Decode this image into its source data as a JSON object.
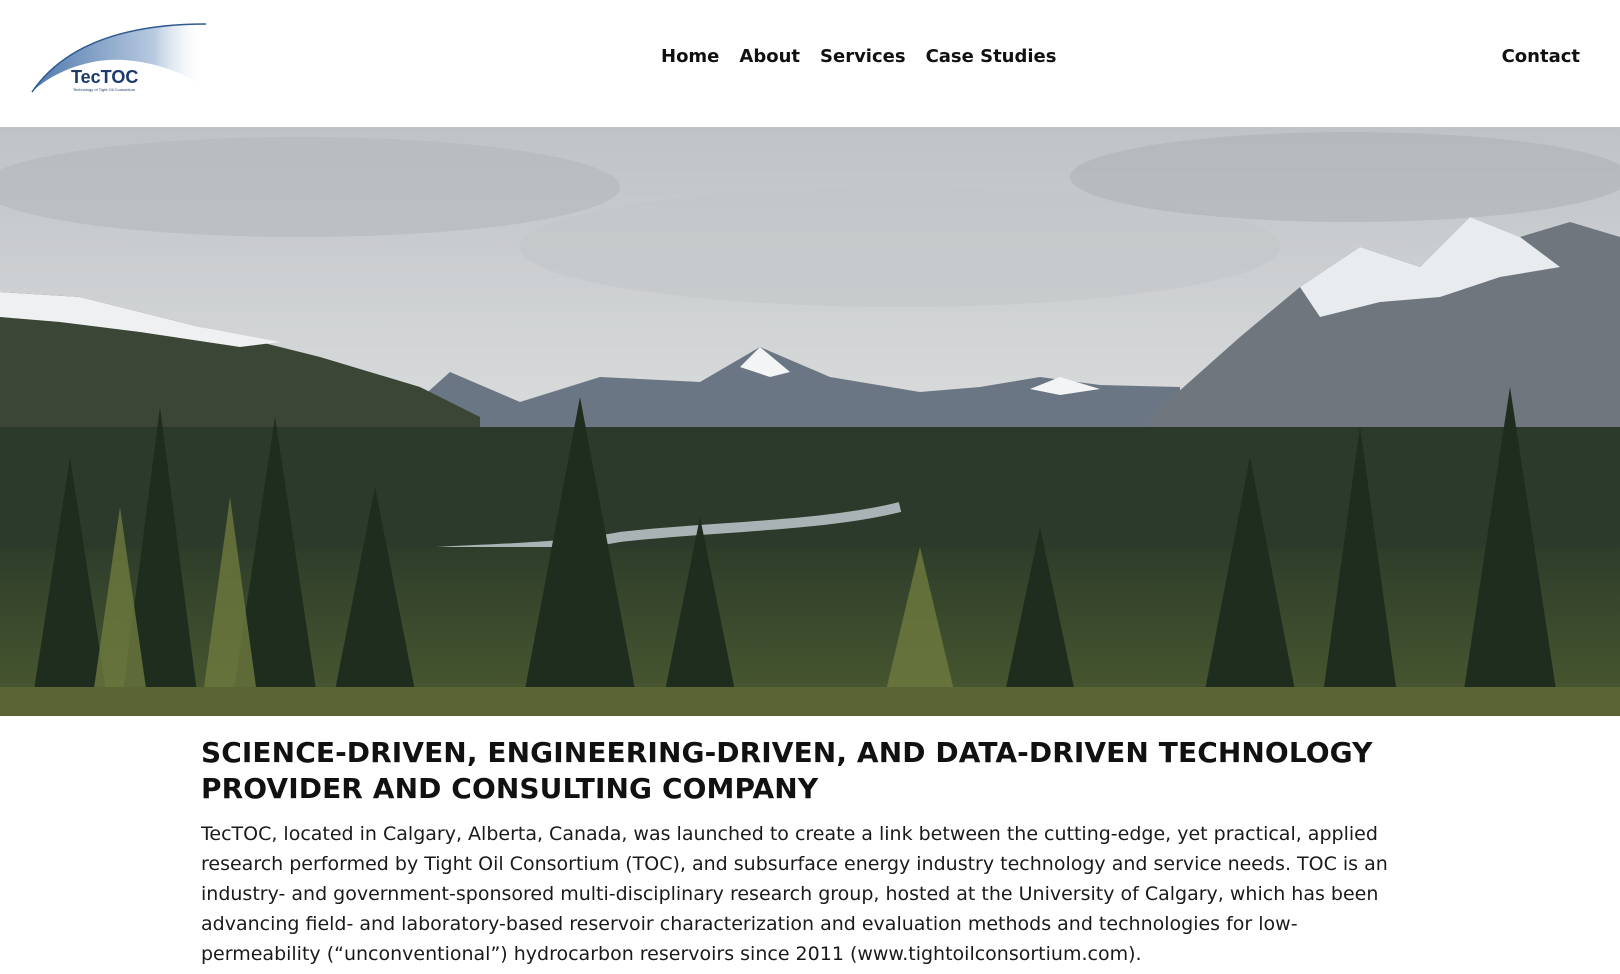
{
  "brand": {
    "logo_text": "TecTOC",
    "logo_tagline": "Technology of Tight Oil Consortium"
  },
  "nav": {
    "items": [
      "Home",
      "About",
      "Services",
      "Case Studies"
    ],
    "contact": "Contact"
  },
  "hero": {
    "image": "mountain-valley-forest-landscape"
  },
  "main": {
    "headline": "SCIENCE-DRIVEN, ENGINEERING-DRIVEN, AND DATA-DRIVEN TECHNOLOGY PROVIDER AND CONSULTING COMPANY",
    "paragraph": "TecTOC, located in Calgary, Alberta, Canada, was launched to create a link between the cutting-edge, yet practical, applied research performed by Tight Oil Consortium (TOC), and subsurface energy industry technology and service needs. TOC is an industry- and government-sponsored multi-disciplinary research group, hosted at the University of Calgary, which has been advancing field- and laboratory-based reservoir characterization and evaluation methods and technologies for low-permeability (“unconventional”) hydrocarbon reservoirs since 2011 (www.tightoilconsortium.com)."
  },
  "colors": {
    "brand_navy": "#1c3a6b",
    "brand_swoosh": "#6f94c0",
    "text": "#111111"
  }
}
